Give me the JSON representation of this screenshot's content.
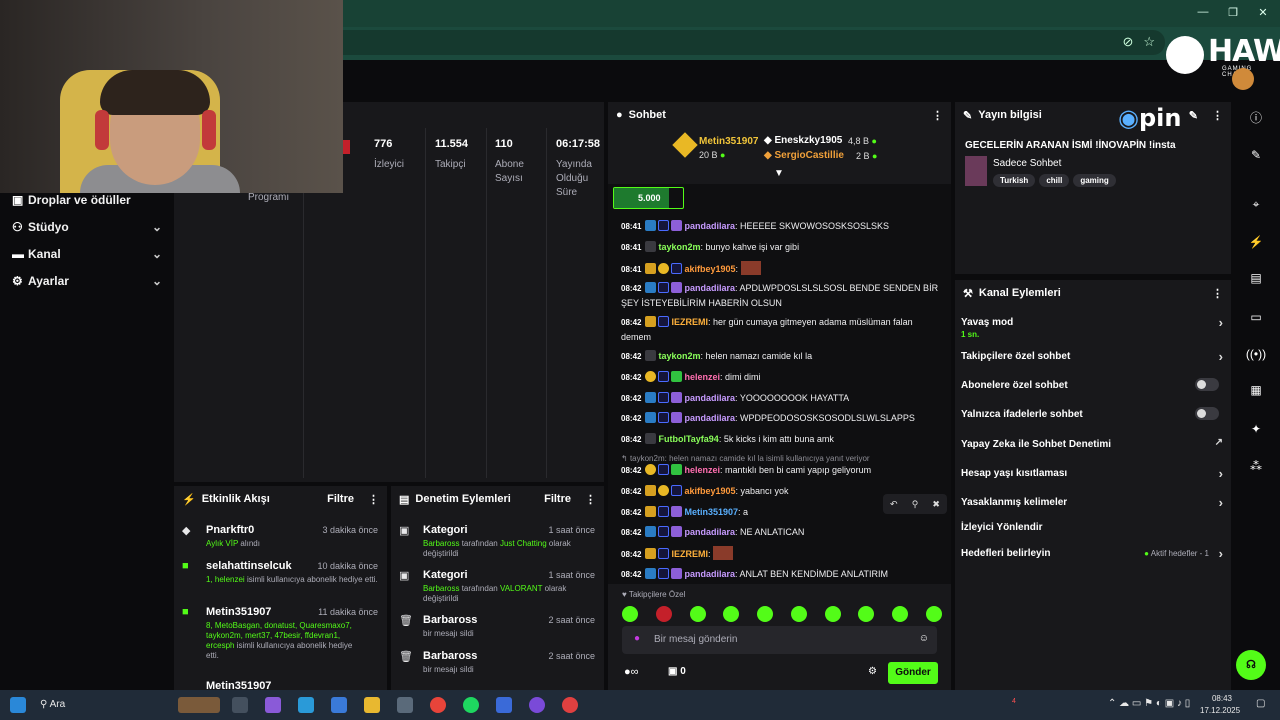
{
  "window": {
    "minimize": "—",
    "restore": "❐",
    "close": "✕"
  },
  "brand": {
    "name": "HAWK",
    "tagline": "GAMING CHAIR"
  },
  "sidebar": {
    "items": [
      {
        "label": "Droplar ve ödüller",
        "icon": "gift-icon"
      },
      {
        "label": "Stüdyo",
        "icon": "video-icon"
      },
      {
        "label": "Kanal",
        "icon": "broadcast-icon"
      },
      {
        "label": "Ayarlar",
        "icon": "gear-icon"
      }
    ]
  },
  "stats": {
    "partial_label": "Programı",
    "items": [
      {
        "value": "776",
        "label": "İzleyici"
      },
      {
        "value": "11.554",
        "label": "Takipçi"
      },
      {
        "value": "110",
        "label": "Abone Sayısı"
      },
      {
        "value": "06:17:58",
        "label": "Yayında Olduğu Süre"
      }
    ]
  },
  "activity": {
    "title": "Etkinlik Akışı",
    "filter": "Filtre",
    "items": [
      {
        "name": "Pnarkftr0",
        "time": "3 dakika önce",
        "desc_green": "Aylık VİP",
        "desc": "alındı"
      },
      {
        "name": "selahattinselcuk",
        "time": "10 dakika önce",
        "desc_green": "1, helenzei",
        "desc": "isimli kullanıcıya abonelik hediye etti."
      },
      {
        "name": "Metin351907",
        "time": "11 dakika önce",
        "desc_green": "8, MetoBasgan, donatust, Quaresmaxo7, taykon2m, mert37, 47besir, ffdevran1, ercesph",
        "desc": "isimli kullanıcıya abonelik hediye etti."
      },
      {
        "name": "Metin351907",
        "time": "",
        "desc_green": "",
        "desc": ""
      }
    ]
  },
  "moderation": {
    "title": "Denetim Eylemleri",
    "filter": "Filtre",
    "items": [
      {
        "name": "Kategori",
        "time": "1 saat önce",
        "actor": "Barbaross",
        "mid": "tarafından",
        "green": "Just Chatting",
        "desc": "olarak değiştirildi"
      },
      {
        "name": "Kategori",
        "time": "1 saat önce",
        "actor": "Barbaross",
        "mid": "tarafından",
        "green": "VALORANT",
        "desc": "olarak değiştirildi"
      },
      {
        "name": "Barbaross",
        "time": "2 saat önce",
        "actor": "",
        "mid": "",
        "green": "",
        "desc": "bir mesajı sildi"
      },
      {
        "name": "Barbaross",
        "time": "2 saat önce",
        "actor": "",
        "mid": "",
        "green": "",
        "desc": "bir mesajı sildi"
      }
    ]
  },
  "chat": {
    "title": "Sohbet",
    "leaders": [
      {
        "name": "Metin351907",
        "amount": "20 B"
      },
      {
        "name": "Eneskzky1905",
        "amount": "4,8 B"
      },
      {
        "name": "SergioCastillie",
        "amount": "2 B"
      }
    ],
    "goal": "5.000",
    "messages": [
      {
        "time": "08:41",
        "user": "pandadilara",
        "color": "#c79bff",
        "text": "HEEEEE SKWOWOSOSKSOSLSKS"
      },
      {
        "time": "08:41",
        "user": "taykon2m",
        "color": "#8aff5a",
        "text": "bunyo kahve işi var gibi"
      },
      {
        "time": "08:41",
        "user": "akifbey1905",
        "color": "#ff9a3c",
        "text": ""
      },
      {
        "time": "08:42",
        "user": "pandadilara",
        "color": "#c79bff",
        "text": "APDLWPDOSLSLSLSOSL BENDE SENDEN BİR ŞEY İSTEYEBİLİRİM HABERİN OLSUN"
      },
      {
        "time": "08:42",
        "user": "IEZREMI",
        "color": "#ffb13c",
        "text": "her gün cumaya gitmeyen adama müslüman falan demem"
      },
      {
        "time": "08:42",
        "user": "taykon2m",
        "color": "#8aff5a",
        "text": "helen namazı camide kıl la"
      },
      {
        "time": "08:42",
        "user": "helenzei",
        "color": "#ff6fb0",
        "text": "dimi dimi"
      },
      {
        "time": "08:42",
        "user": "pandadilara",
        "color": "#c79bff",
        "text": "YOOOOOOOOK HAYATTA"
      },
      {
        "time": "08:42",
        "user": "pandadilara",
        "color": "#c79bff",
        "text": "WPDPEODOSOSKSOSODLSLWLSLAPPS"
      },
      {
        "time": "08:42",
        "user": "FutbolTayfa94",
        "color": "#8aff5a",
        "text": "5k kicks i kim attı buna amk"
      },
      {
        "time": "08:42",
        "user": "helenzei",
        "color": "#ff6fb0",
        "text": "mantıklı ben bi cami yapıp geliyorum"
      },
      {
        "time": "08:42",
        "user": "akifbey1905",
        "color": "#ff9a3c",
        "text": "yabancı yok"
      },
      {
        "time": "08:42",
        "user": "Metin351907",
        "color": "#5ab0ff",
        "text": "a"
      },
      {
        "time": "08:42",
        "user": "pandadilara",
        "color": "#c79bff",
        "text": "NE ANLATICAN"
      },
      {
        "time": "08:42",
        "user": "IEZREMI",
        "color": "#ffb13c",
        "text": ""
      },
      {
        "time": "08:42",
        "user": "pandadilara",
        "color": "#c79bff",
        "text": "ANLAT BEN KENDİMDE ANLATIRIM"
      }
    ],
    "reply_note": "taykon2m: helen namazı camide kıl la isimli kullanıcıya yanıt veriyor",
    "followers_only": "Takipçilere Özel",
    "input_placeholder": "Bir mesaj gönderin",
    "kicks": "0",
    "send": "Gönder"
  },
  "stream_info": {
    "title": "Yayın bilgisi",
    "stream_title": "GECELERİN ARANAN İSMİ !İNOVAPİN !insta",
    "category": "Sadece Sohbet",
    "tags": [
      "Turkish",
      "chill",
      "gaming"
    ],
    "overlay_brand": "pin"
  },
  "channel_actions": {
    "title": "Kanal Eylemleri",
    "items": [
      {
        "label": "Yavaş mod",
        "sub": "1 sn.",
        "control": "chevron"
      },
      {
        "label": "Takipçilere özel sohbet",
        "sub": "",
        "control": "chevron"
      },
      {
        "label": "Abonelere özel sohbet",
        "sub": "",
        "control": "toggle"
      },
      {
        "label": "Yalnızca ifadelerle sohbet",
        "sub": "",
        "control": "toggle"
      },
      {
        "label": "Yapay Zeka ile Sohbet Denetimi",
        "sub": "",
        "control": "external"
      },
      {
        "label": "Hesap yaşı kısıtlaması",
        "sub": "",
        "control": "chevron"
      },
      {
        "label": "Yasaklanmış kelimeler",
        "sub": "",
        "control": "chevron"
      },
      {
        "label": "İzleyici Yönlendir",
        "sub": "",
        "control": "none"
      },
      {
        "label": "Hedefleri belirleyin",
        "sub": "",
        "control": "chevron"
      }
    ],
    "goals_status": "Aktif hedefler - 1"
  },
  "taskbar": {
    "search": "Ara",
    "time": "08:43",
    "date": "17.12.2025",
    "notification_count": "4"
  }
}
